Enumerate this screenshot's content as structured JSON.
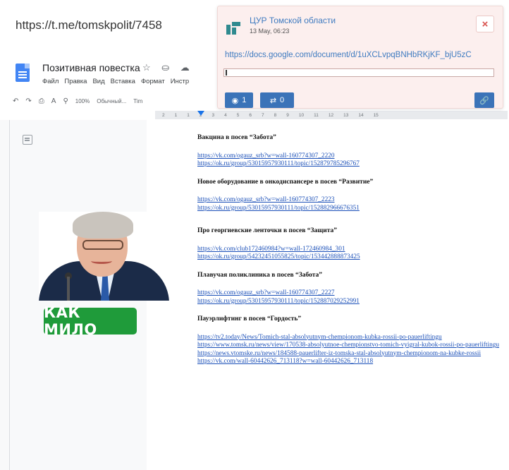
{
  "top_url": "https://t.me/tomskpolit/7458",
  "docs": {
    "title": "Позитивная повестка",
    "title_icons": "☆ ⛀ ☁",
    "menu": [
      "Файл",
      "Правка",
      "Вид",
      "Вставка",
      "Формат",
      "Инстр"
    ],
    "toolbar": {
      "zoom": "100%",
      "style": "Обычный...",
      "font": "Tim"
    },
    "ruler_ticks": [
      "2",
      "1",
      "1",
      "2",
      "3",
      "4",
      "5",
      "6",
      "7",
      "8",
      "9",
      "10",
      "11",
      "12",
      "13",
      "14",
      "15"
    ]
  },
  "card": {
    "source": "ЦУР Томской области",
    "date": "13 May, 06:23",
    "url": "https://docs.google.com/document/d/1uXCLvpqBNHbRKjKF_bjU5zC",
    "close_label": "×",
    "views": "1",
    "reposts": "0"
  },
  "sticker_text": "КАК МИЛО",
  "sections": [
    {
      "heading": "Вакцина в посев “Забота”",
      "links": [
        "https://vk.com/ogauz_srb?w=wall-160774307_2220",
        "https://ok.ru/group/53015957930111/topic/152879785296767"
      ]
    },
    {
      "heading": "Новое оборудование в онкодиспансере в посев “Развитие”",
      "links": [
        "https://vk.com/ogauz_srb?w=wall-160774307_2223",
        "https://ok.ru/group/53015957930111/topic/152882966676351"
      ]
    },
    {
      "heading": "Про георгиевские ленточки в посев “Защита”",
      "links": [
        "https://vk.com/club172460984?w=wall-172460984_301",
        "https://ok.ru/group/54232451055825/topic/153442888873425"
      ]
    },
    {
      "heading": "Плавучая поликлиника в посев “Забота”",
      "links": [
        "https://vk.com/ogauz_srb?w=wall-160774307_2227",
        "https://ok.ru/group/53015957930111/topic/152887029252991"
      ]
    },
    {
      "heading": "Пауэрлифтинг в посев “Гордость”",
      "links": [
        "https://tv2.today/News/Tomich-stal-absolyutnym-chempionom-kubka-rossii-po-pauerliftingu",
        "https://www.tomsk.ru/news/view/170538-absolyutnoe-chempionstvo-tomich-vyigral-kubok-rossii-po-pauerliftingu",
        "https://news.vtomske.ru/news/184588-pauerlifter-iz-tomska-stal-absolyutnym-chempionom-na-kubke-rossii",
        "https://vk.com/wall-60442626_713118?w=wall-60442626_713118"
      ]
    }
  ]
}
